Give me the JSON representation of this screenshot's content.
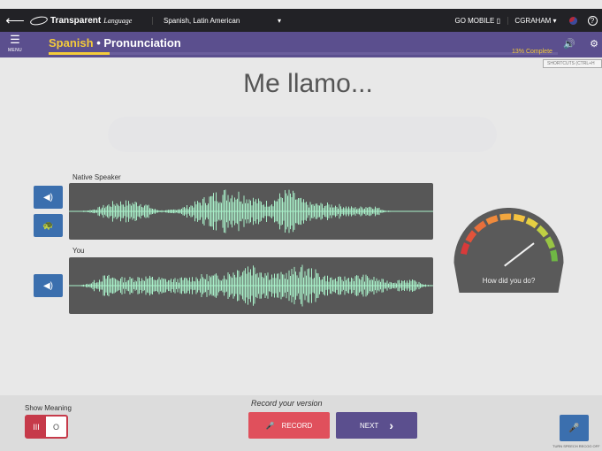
{
  "topbar": {
    "back_glyph": "⟵",
    "logo_text": "Transparent",
    "logo_script": "Language",
    "language": "Spanish, Latin American",
    "language_caret": "▾",
    "go_mobile": "GO MOBILE ▯",
    "user": "CGRAHAM ▾",
    "help_glyph": "?"
  },
  "subbar": {
    "menu_glyph": "☰",
    "menu_label": "MENU",
    "course_language": "Spanish",
    "separator": " • ",
    "course_section": "Pronunciation",
    "progress_fraction": 0.12,
    "complete_text": "13% Complete",
    "sound_glyph": "🔊",
    "settings_glyph": "⚙"
  },
  "shortcuts_label": "SHORTCUTS (CTRL+H",
  "phrase": "Me llamo...",
  "native": {
    "label": "Native Speaker",
    "play_glyph": "◀)",
    "slow_glyph": "🐢"
  },
  "you": {
    "label": "You",
    "play_glyph": "◀)"
  },
  "gauge": {
    "label": "How did you do?",
    "colors": [
      "#d93a3a",
      "#e2533a",
      "#e86f3b",
      "#ef8a3c",
      "#f1a63e",
      "#f3c240",
      "#e4cf42",
      "#bfd043",
      "#98c544",
      "#6fb745"
    ],
    "score_fraction": 0.78
  },
  "bottom": {
    "show_meaning_label": "Show Meaning",
    "toggle_on": "III",
    "toggle_off": "O",
    "record_prompt": "Record your version",
    "record_icon": "🎤",
    "record_label": "RECORD",
    "next_label": "NEXT",
    "next_chevron": "›",
    "speech_icon": "🎤",
    "speech_label": "TURN SPEECH RECOG OFF"
  },
  "colors": {
    "wave": "#a9f0c9",
    "wave_bg": "#575757",
    "accent_purple": "#5b4f8e",
    "accent_red": "#e0505c",
    "accent_blue": "#3b6fae"
  }
}
